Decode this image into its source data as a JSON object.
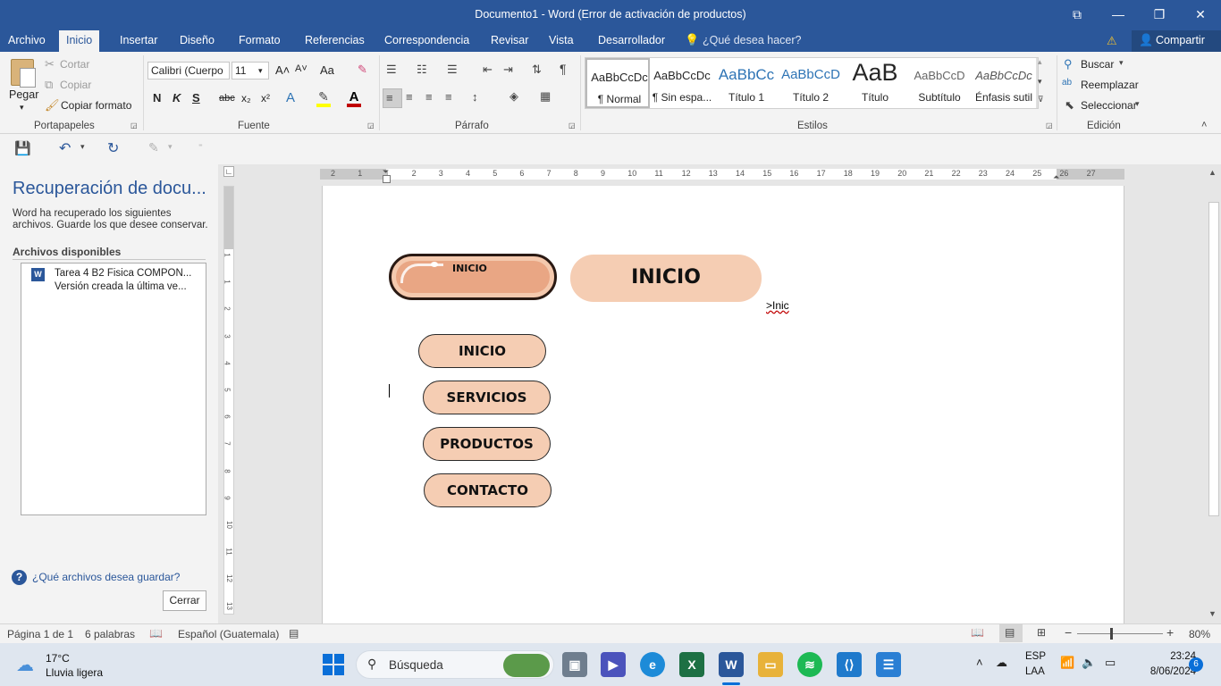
{
  "window": {
    "title": "Documento1 - Word (Error de activación de productos)",
    "restore_glyph": "⧉",
    "minimize_glyph": "—",
    "maximize_glyph": "❐",
    "close_glyph": "✕",
    "accent": "#2b579a"
  },
  "tabs": [
    {
      "label": "Archivo"
    },
    {
      "label": "Inicio"
    },
    {
      "label": "Insertar"
    },
    {
      "label": "Diseño"
    },
    {
      "label": "Formato"
    },
    {
      "label": "Referencias"
    },
    {
      "label": "Correspondencia"
    },
    {
      "label": "Revisar"
    },
    {
      "label": "Vista"
    },
    {
      "label": "Desarrollador"
    }
  ],
  "tell_me": {
    "placeholder": "¿Qué desea hacer?"
  },
  "share": {
    "label": "Compartir"
  },
  "clipboard": {
    "paste": "Pegar",
    "cut": "Cortar",
    "copy": "Copiar",
    "format_painter": "Copiar formato",
    "group": "Portapapeles"
  },
  "font": {
    "name": "Calibri (Cuerpo",
    "size": "11",
    "group": "Fuente",
    "bold": "N",
    "italic": "K",
    "underline": "S",
    "strike": "abc",
    "sub": "x₂",
    "sup": "x²",
    "case": "Aa",
    "grow": "A˄",
    "shrink": "A˅"
  },
  "paragraph": {
    "group": "Párrafo"
  },
  "styles": {
    "group": "Estilos",
    "items": [
      {
        "preview": "AaBbCcDc",
        "name": "¶ Normal"
      },
      {
        "preview": "AaBbCcDc",
        "name": "¶ Sin espa..."
      },
      {
        "preview": "AaBbCc",
        "name": "Título 1"
      },
      {
        "preview": "AaBbCcD",
        "name": "Título 2"
      },
      {
        "preview": "AaB",
        "name": "Título"
      },
      {
        "preview": "AaBbCcD",
        "name": "Subtítulo"
      },
      {
        "preview": "AaBbCcDc",
        "name": "Énfasis sutil"
      }
    ]
  },
  "editing": {
    "group": "Edición",
    "find": "Buscar",
    "replace": "Reemplazar",
    "select": "Seleccionar"
  },
  "recovery": {
    "title": "Recuperación de docu...",
    "description": "Word ha recuperado los siguientes archivos. Guarde los que desee conservar.",
    "available": "Archivos disponibles",
    "file_name": "Tarea 4 B2 Fisica COMPON...",
    "file_version": "Versión creada la última ve...",
    "help_link": "¿Qué archivos desea guardar?",
    "close": "Cerrar"
  },
  "ruler": {
    "numbers": [
      "2",
      "1",
      "1",
      "2",
      "3",
      "4",
      "5",
      "6",
      "7",
      "8",
      "9",
      "10",
      "11",
      "12",
      "13",
      "14",
      "15",
      "16",
      "17",
      "18",
      "19",
      "20",
      "21",
      "22",
      "23",
      "24",
      "25",
      "26",
      "27"
    ],
    "v_numbers": [
      "1",
      "1",
      "2",
      "3",
      "4",
      "5",
      "6",
      "7",
      "8",
      "9",
      "10",
      "11",
      "12",
      "13"
    ]
  },
  "document": {
    "button_small": "INICIO",
    "button_large": "INICIO",
    "typed_text": ">Inic",
    "menu": [
      "INICIO",
      "SERVICIOS",
      "PRODUCTOS",
      "CONTACTO"
    ]
  },
  "status": {
    "page": "Página 1 de 1",
    "words": "6 palabras",
    "language": "Español (Guatemala)",
    "zoom": "80%",
    "zoom_value": 0.8
  },
  "taskbar": {
    "temp": "17°C",
    "weather": "Lluvia ligera",
    "search": "Búsqueda",
    "lang": "ESP",
    "lang2": "LAA",
    "time": "23:24",
    "date": "8/06/2024",
    "notifications": "6"
  }
}
